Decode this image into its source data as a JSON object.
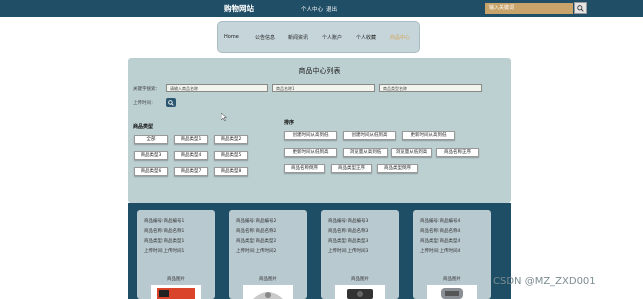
{
  "header": {
    "site_title": "购物网站",
    "user_center": "个人中心",
    "logout": "退出",
    "search_placeholder": "输入关键词"
  },
  "nav": {
    "items": [
      "Home",
      "公告信息",
      "新闻资讯",
      "个人账户",
      "个人收藏",
      "商品中心"
    ],
    "active_index": 5
  },
  "panel": {
    "title": "商品中心列表",
    "search": {
      "label_keyword": "关键字搜索：",
      "label_date": "上传时间：",
      "field1": "请输入商品名称",
      "field2": "商品名称1",
      "field3": "商品类型名称"
    },
    "category": {
      "title": "商品类型",
      "chips": [
        "全部",
        "商品类型1",
        "商品类型2",
        "商品类型3",
        "商品类型4",
        "商品类型5",
        "商品类型6",
        "商品类型7",
        "商品类型8"
      ]
    },
    "sort": {
      "title": "排序",
      "chips": [
        "创建时间从高到低",
        "创建时间从低到高",
        "更新时间从高到低",
        "更新时间从低到高",
        "浏览量从高到低",
        "浏览量从低到高",
        "商品名称正序",
        "商品名称倒序",
        "商品类型正序",
        "商品类型倒序"
      ]
    }
  },
  "cards": [
    {
      "lines": [
        "商品编号:商品编号1",
        "商品名称:商品名称1",
        "商品类型:商品类型1",
        "上传时间:上传时间1"
      ],
      "image_label": "商品图片"
    },
    {
      "lines": [
        "商品编号:商品编号2",
        "商品名称:商品名称2",
        "商品类型:商品类型2",
        "上传时间:上传时间2"
      ],
      "image_label": "商品图片"
    },
    {
      "lines": [
        "商品编号:商品编号3",
        "商品名称:商品名称3",
        "商品类型:商品类型3",
        "上传时间:上传时间3"
      ],
      "image_label": "商品图片"
    },
    {
      "lines": [
        "商品编号:商品编号4",
        "商品名称:商品名称4",
        "商品类型:商品类型4",
        "上传时间:上传时间4"
      ],
      "image_label": "商品图片"
    }
  ],
  "watermark": "CSDN @MZ_ZXD001",
  "colors": {
    "header_bg": "#1f4e66",
    "accent": "#c8a46a",
    "panel_bg": "#bccfd1"
  }
}
